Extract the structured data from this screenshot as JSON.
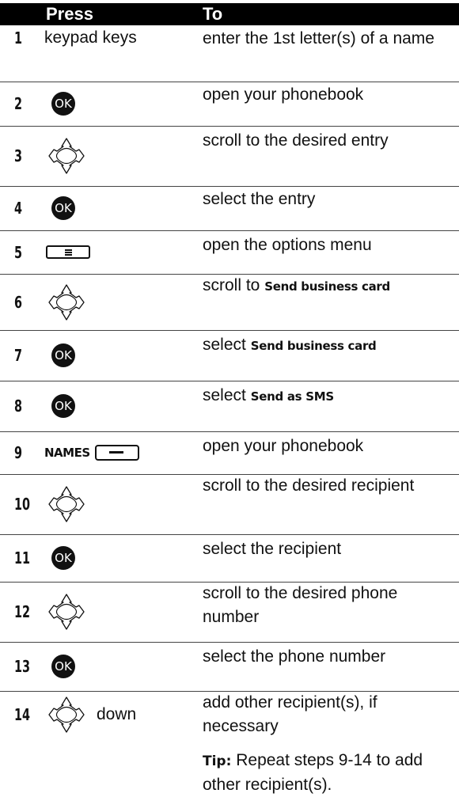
{
  "header": {
    "press": "Press",
    "to": "To"
  },
  "rows": [
    {
      "num": "1",
      "press_text": "keypad keys",
      "to": "enter the 1st letter(s) of a name"
    },
    {
      "num": "2",
      "icon": "ok-icon",
      "icon_text": "OK",
      "to": "open your phonebook"
    },
    {
      "num": "3",
      "icon": "nav-key-icon",
      "to": "scroll to the desired entry"
    },
    {
      "num": "4",
      "icon": "ok-icon",
      "icon_text": "OK",
      "to": "select the entry"
    },
    {
      "num": "5",
      "icon": "menu-key-icon",
      "to": "open the options menu"
    },
    {
      "num": "6",
      "icon": "nav-key-icon",
      "to_prefix": "scroll to ",
      "to_kw": "Send business card"
    },
    {
      "num": "7",
      "icon": "ok-icon",
      "icon_text": "OK",
      "to_prefix": "select ",
      "to_kw": "Send business card"
    },
    {
      "num": "8",
      "icon": "ok-icon",
      "icon_text": "OK",
      "to_prefix": "select ",
      "to_kw": "Send as SMS"
    },
    {
      "num": "9",
      "press_label": "NAMES",
      "icon": "soft-key-icon",
      "to": "open your phonebook"
    },
    {
      "num": "10",
      "icon": "nav-key-icon",
      "to": "scroll to the desired recipient"
    },
    {
      "num": "11",
      "icon": "ok-icon",
      "icon_text": "OK",
      "to": "select the recipient"
    },
    {
      "num": "12",
      "icon": "nav-key-icon",
      "to": "scroll to the desired phone number"
    },
    {
      "num": "13",
      "icon": "ok-icon",
      "icon_text": "OK",
      "to": "select the phone number"
    },
    {
      "num": "14",
      "icon": "nav-key-icon",
      "press_text": "down",
      "to": "add other recipient(s), if necessary"
    }
  ],
  "tip": {
    "label": "Tip:",
    "text": " Repeat steps 9-14 to add other recipient(s)."
  }
}
